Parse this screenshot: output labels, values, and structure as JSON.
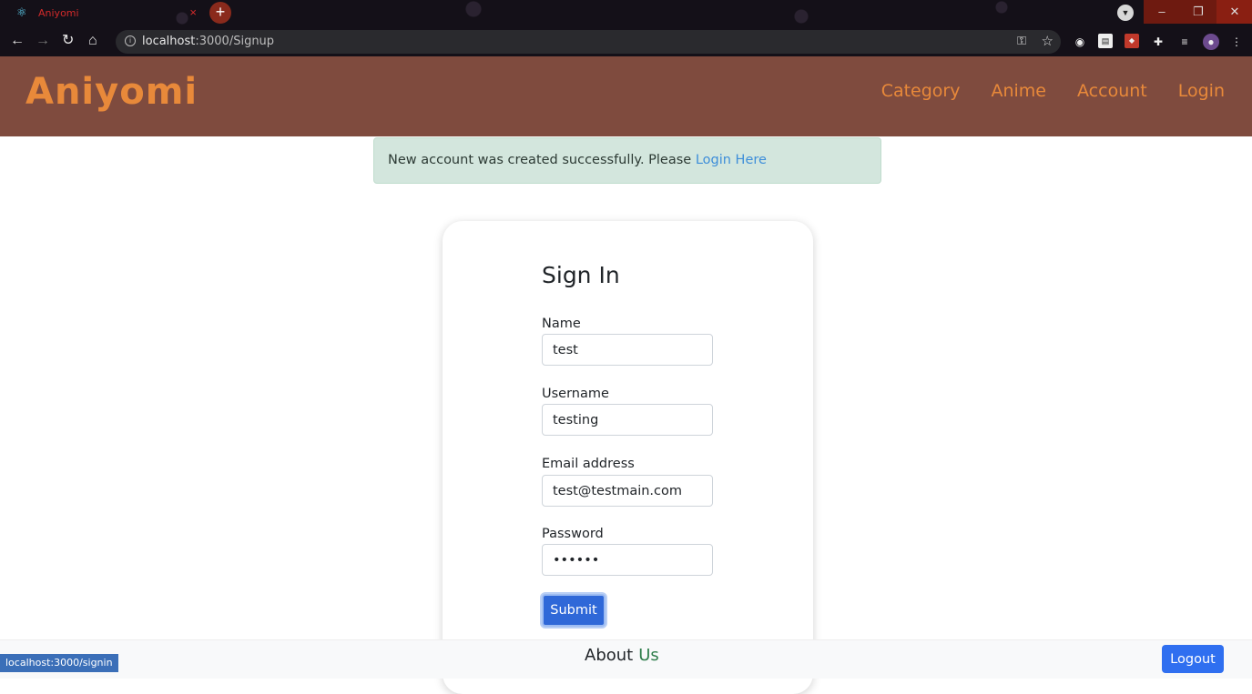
{
  "browser": {
    "tab_title": "Aniyomi",
    "tab_close": "×",
    "new_tab": "+",
    "url_host": "localhost",
    "url_rest": ":3000/Signup",
    "status_url": "localhost:3000/signin",
    "minimize": "–",
    "restore": "❐",
    "close": "✕"
  },
  "site_nav": {
    "brand": "Aniyomi",
    "links": [
      "Category",
      "Anime",
      "Account",
      "Login"
    ]
  },
  "alert": {
    "text": "New account was created successfully. Please ",
    "link": "Login Here"
  },
  "form": {
    "title": "Sign In",
    "name_label": "Name",
    "name_value": "test",
    "username_label": "Username",
    "username_value": "testing",
    "email_label": "Email address",
    "email_value": "test@testmain.com",
    "password_label": "Password",
    "password_value": "••••••",
    "submit": "Submit"
  },
  "footer": {
    "about": "About",
    "us": "Us",
    "logout": "Logout"
  },
  "colors": {
    "navbar": "#7f4b3e",
    "brand": "#e8893a",
    "alert_bg": "#d3e6dd",
    "primary": "#2f6ff0"
  }
}
